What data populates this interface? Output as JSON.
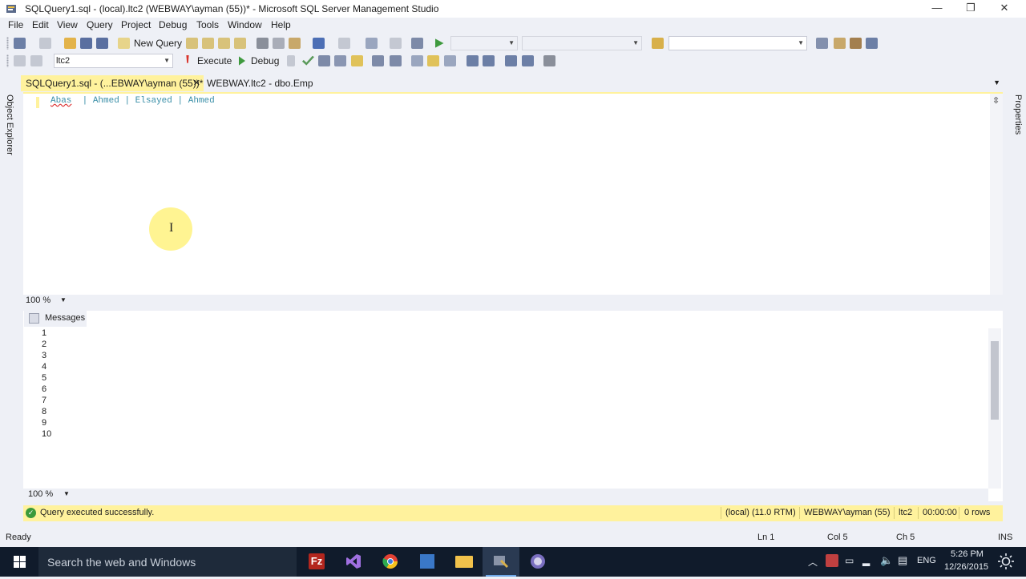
{
  "window": {
    "title": "SQLQuery1.sql - (local).ltc2 (WEBWAY\\ayman (55))* - Microsoft SQL Server Management Studio",
    "minimize_glyph": "—",
    "maximize_glyph": "❐",
    "close_glyph": "✕"
  },
  "menu": [
    "File",
    "Edit",
    "View",
    "Query",
    "Project",
    "Debug",
    "Tools",
    "Window",
    "Help"
  ],
  "toolbar1": {
    "new_query_label": "New Query"
  },
  "toolbar2": {
    "database_value": "ltc2",
    "execute_label": "Execute",
    "debug_label": "Debug"
  },
  "side_panels": {
    "left_label": "Object Explorer",
    "right_label": "Properties"
  },
  "doc_tabs": [
    {
      "label": "SQLQuery1.sql - (...EBWAY\\ayman (55))*",
      "active": true,
      "close_glyph": "✕"
    },
    {
      "label": "WEBWAY.ltc2 - dbo.Emp",
      "active": false
    }
  ],
  "editor": {
    "tokens": [
      "Abas",
      "|",
      "Ahmed",
      "|",
      "Elsayed",
      "|",
      "Ahmed"
    ],
    "zoom": "100 %"
  },
  "results": {
    "tab_label": "Messages",
    "lines": [
      "1",
      "2",
      "3",
      "4",
      "5",
      "6",
      "7",
      "8",
      "9",
      "10"
    ],
    "zoom": "100 %"
  },
  "query_status": {
    "message": "Query executed successfully.",
    "server": "(local) (11.0 RTM)",
    "user": "WEBWAY\\ayman (55)",
    "database": "ltc2",
    "elapsed": "00:00:00",
    "rows": "0 rows"
  },
  "app_status": {
    "state": "Ready",
    "line": "Ln 1",
    "col": "Col 5",
    "ch": "Ch 5",
    "mode": "INS"
  },
  "taskbar": {
    "search_placeholder": "Search the web and Windows",
    "lang": "ENG",
    "time": "5:26 PM",
    "date": "12/26/2015"
  },
  "colors": {
    "accent_yellow": "#fff29d",
    "chrome": "#eef0f6",
    "taskbar": "#101b2b",
    "token": "#3a8fa8"
  }
}
